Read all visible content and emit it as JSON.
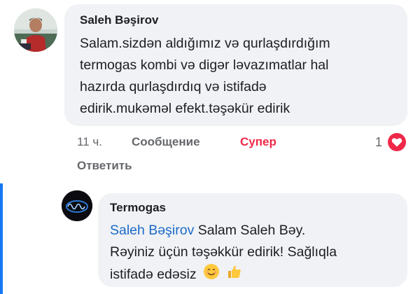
{
  "comment": {
    "author": "Saleh Bəşirov",
    "lines": [
      "Salam.sizdən aldığımız və qurlaşdırdığım",
      "termogas kombi və digər ləvazımatlar hal",
      "hazırda qurlaşdırdıq və istifadə",
      "edirik.mukəməl efekt.təşəkür edirik"
    ],
    "time": "11 ч.",
    "message_label": "Сообщение",
    "reaction_label": "Супер",
    "reply_label": "Ответить",
    "reaction_count": "1",
    "reaction_icon": "heart-icon",
    "colors": {
      "reaction": "#f02849",
      "thread_bar": "#1877f2",
      "mention": "#1b6ac9"
    }
  },
  "reply": {
    "author": "Termogas",
    "mention": "Saleh Bəşirov",
    "line1_rest": " Salam Saleh Bəy.",
    "line2": "Rəyiniz üçün təşəkkür edirik! Sağlıqla",
    "line3": "istifadə edəsiz",
    "emojis": [
      "smiling-face-icon",
      "thumbs-up-icon"
    ]
  }
}
